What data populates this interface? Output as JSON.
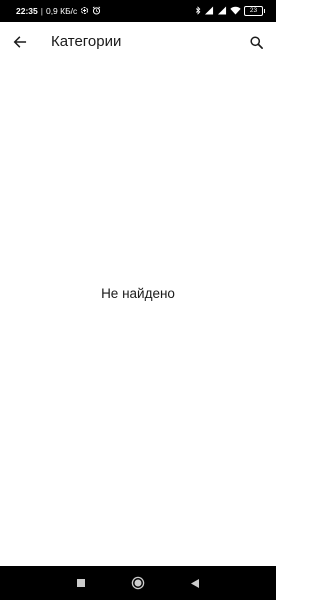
{
  "status_bar": {
    "time": "22:35",
    "separator": "|",
    "network_speed": "0,9 КБ/с",
    "battery_level": "23",
    "icons": [
      "data-saver-icon",
      "alarm-icon",
      "bluetooth-icon",
      "signal-icon",
      "signal-icon",
      "wifi-icon",
      "battery-icon"
    ]
  },
  "app_bar": {
    "title": "Категории",
    "back_icon": "arrow-back-icon",
    "search_icon": "search-icon"
  },
  "content": {
    "empty_message": "Не найдено"
  },
  "nav_bar": {
    "icons": [
      "recents-icon",
      "home-icon",
      "back-icon"
    ]
  },
  "colors": {
    "background": "#ffffff",
    "status_bar": "#000000",
    "nav_bar": "#000000",
    "text": "#1a1a1a",
    "nav_icons": "#cccccc"
  }
}
